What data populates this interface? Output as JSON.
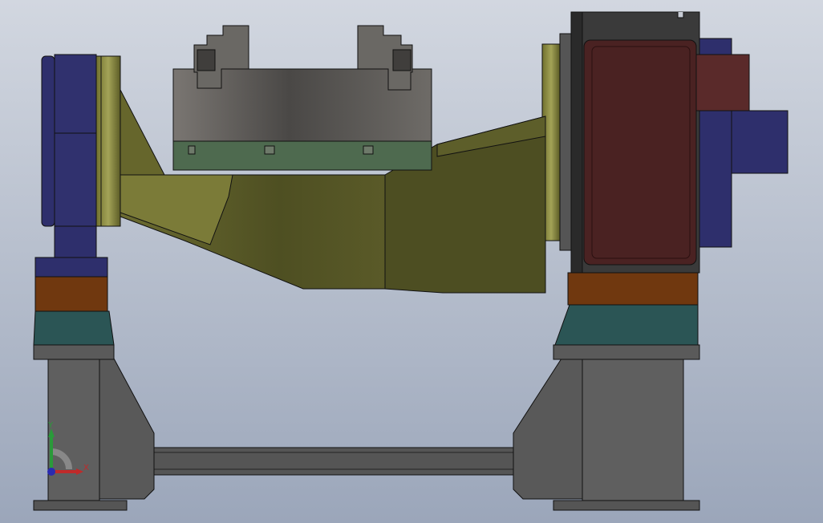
{
  "viewport": {
    "background_top": "#d2d7e0",
    "background_bottom": "#9ba6ba"
  },
  "model": {
    "parts": {
      "frame_color": "#5d5d5d",
      "frame_dark": "#404040",
      "teal_color": "#2b5555",
      "brown_color": "#70380f",
      "navy_color": "#2e2f6c",
      "olive_color": "#5d5e2a",
      "olive_light": "#8e8e46",
      "maroon_color": "#4a2222",
      "chuck_color": "#6c6a66",
      "green_plate": "#4e6a4f"
    }
  },
  "triad": {
    "x_label": "X",
    "y_label": "Y",
    "x_color": "#c02a2a",
    "y_color": "#2a9a3a",
    "z_color": "#2a2ab0"
  }
}
